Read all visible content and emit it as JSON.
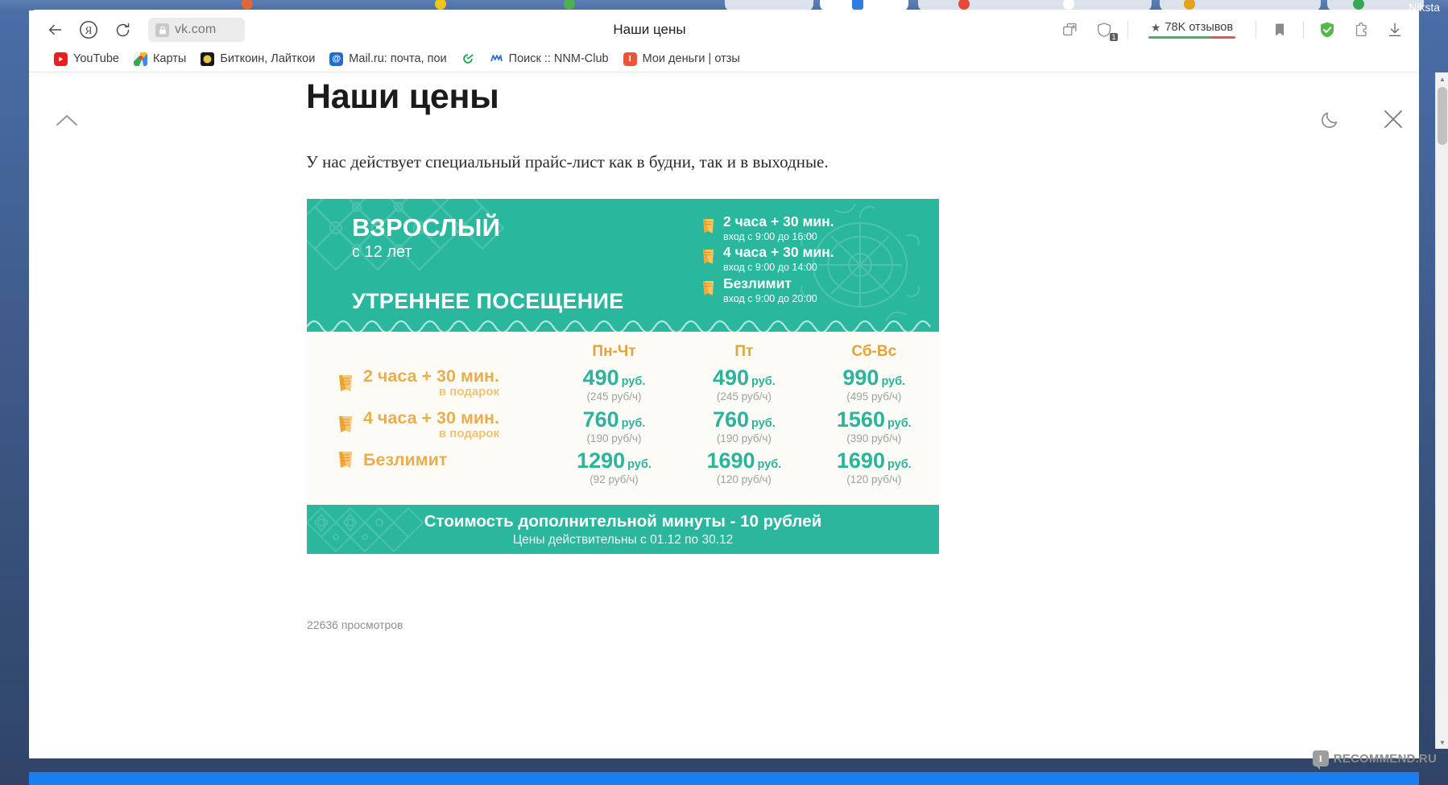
{
  "desktop": {
    "user_label": "Niksta"
  },
  "browser": {
    "nav": {
      "back_label": "Назад",
      "yandex_label": "Яндекс",
      "reload_label": "Обновить"
    },
    "omnibox": {
      "url": "vk.com",
      "lock_icon": "lock-icon"
    },
    "tab_title": "Наши цены",
    "right_tools": {
      "collections_icon": "collections-icon",
      "shield_count": "1",
      "reviews_text": "78K отзывов",
      "reviews_star": "★",
      "reviews_bar_green": "#3fb56a",
      "reviews_bar_red": "#e05a4a",
      "bookmark_icon": "bookmark-icon",
      "adguard_icon": "adguard-shield-icon",
      "adguard_color": "#54b948",
      "extension_icon": "puzzle-extension-icon",
      "download_icon": "download-icon"
    },
    "bookmarks": [
      {
        "label": "YouTube",
        "icon": "youtube-icon",
        "color": "#ee1d1d",
        "glyph": "▶"
      },
      {
        "label": "Карты",
        "icon": "google-maps-icon",
        "color": "#34a853",
        "glyph": ""
      },
      {
        "label": "Биткоин, Лайткои",
        "icon": "bitcoin-icon",
        "color": "#1c1c1c",
        "glyph": ""
      },
      {
        "label": "Mail.ru: почта, пои",
        "icon": "mailru-icon",
        "color": "#1a6fd4",
        "glyph": "@"
      },
      {
        "label": "",
        "icon": "sberbank-icon",
        "color": "#ffffff",
        "glyph": ""
      },
      {
        "label": "Поиск :: NNM-Club",
        "icon": "nnm-club-icon",
        "color": "#ffffff",
        "glyph": ""
      },
      {
        "label": "Мои деньги | отзы",
        "icon": "irecommend-icon",
        "color": "#ef5234",
        "glyph": "I"
      }
    ]
  },
  "page": {
    "back_to_top_icon": "chevron-up-icon",
    "dark_mode_icon": "moon-icon",
    "close_icon": "close-icon",
    "title": "Наши цены",
    "intro": "У нас действует специальный прайс-лист как в будни, так и в выходные.",
    "views": "22636 просмотров",
    "watermark": {
      "badge_letter": "I",
      "text": "RECOMMEND.RU"
    }
  },
  "price_card": {
    "colors": {
      "teal": "#29b79d",
      "teal_dark": "#2ab79e",
      "cream": "#fdfbf6",
      "orange": "#e9ae4b",
      "orange_head": "#e3a33d",
      "price_green": "#2bb49b",
      "per_hour_gray": "#9aa3a1"
    },
    "header": {
      "category": "ВЗРОСЛЫЙ",
      "age": "с 12 лет",
      "visit_type": "УТРЕННЕЕ ПОСЕЩЕНИЕ",
      "options": [
        {
          "title": "2 часа + 30 мин.",
          "entry": "вход с 9:00 до 16:00",
          "icon": "ticket-icon"
        },
        {
          "title": "4 часа + 30 мин.",
          "entry": "вход с 9:00 до 14:00",
          "icon": "ticket-icon"
        },
        {
          "title": "Безлимит",
          "entry": "вход с 9:00 до 20:00",
          "icon": "ticket-icon"
        }
      ]
    },
    "table": {
      "columns": [
        "Пн-Чт",
        "Пт",
        "Сб-Вс"
      ],
      "rows": [
        {
          "label": "2 часа + 30 мин.",
          "gift": "в подарок",
          "icon": "ticket-icon",
          "cells": [
            {
              "amount": "490",
              "currency": "руб.",
              "per_hour": "(245 руб/ч)"
            },
            {
              "amount": "490",
              "currency": "руб.",
              "per_hour": "(245 руб/ч)"
            },
            {
              "amount": "990",
              "currency": "руб.",
              "per_hour": "(495 руб/ч)"
            }
          ]
        },
        {
          "label": "4 часа + 30 мин.",
          "gift": "в подарок",
          "icon": "ticket-icon",
          "cells": [
            {
              "amount": "760",
              "currency": "руб.",
              "per_hour": "(190 руб/ч)"
            },
            {
              "amount": "760",
              "currency": "руб.",
              "per_hour": "(190 руб/ч)"
            },
            {
              "amount": "1560",
              "currency": "руб.",
              "per_hour": "(390 руб/ч)"
            }
          ]
        },
        {
          "label": "Безлимит",
          "gift": "",
          "icon": "ticket-icon",
          "cells": [
            {
              "amount": "1290",
              "currency": "руб.",
              "per_hour": "(92 руб/ч)"
            },
            {
              "amount": "1690",
              "currency": "руб.",
              "per_hour": "(120 руб/ч)"
            },
            {
              "amount": "1690",
              "currency": "руб.",
              "per_hour": "(120 руб/ч)"
            }
          ]
        }
      ]
    },
    "footer": {
      "extra_minute": "Стоимость дополнительной минуты - 10 рублей",
      "valid": "Цены действительны с 01.12 по 30.12"
    }
  }
}
